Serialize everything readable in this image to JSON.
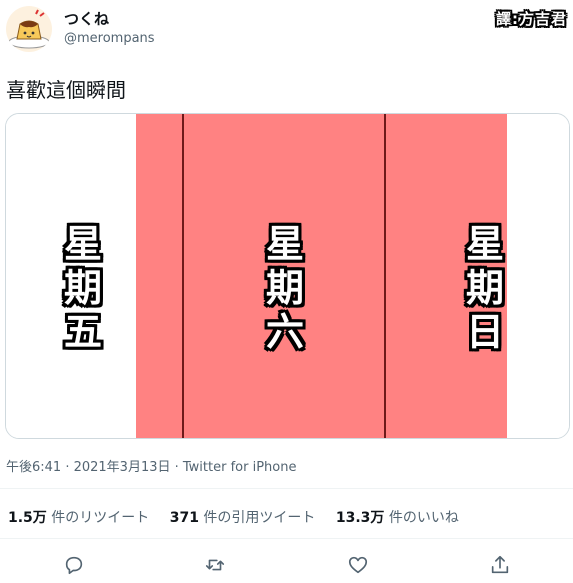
{
  "author": {
    "display_name": "つくね",
    "handle": "@merompans"
  },
  "translator_badge": "譯:方吉君",
  "tweet": {
    "text": "喜歡這個瞬間",
    "timestamp": "午後6:41 · 2021年3月13日 · Twitter for iPhone"
  },
  "media": {
    "days": [
      "星\n期\n五",
      "星\n期\n六",
      "星\n期\n日"
    ],
    "colors": {
      "highlight": "#ff8282",
      "divider": "#6e1a1a",
      "background": "#ffffff"
    }
  },
  "stats": {
    "retweets_count": "1.5万",
    "retweets_label": "件のリツイート",
    "quotes_count": "371",
    "quotes_label": "件の引用ツイート",
    "likes_count": "13.3万",
    "likes_label": "件のいいね"
  },
  "actions": [
    "reply-icon",
    "retweet-icon",
    "like-icon",
    "share-icon"
  ]
}
